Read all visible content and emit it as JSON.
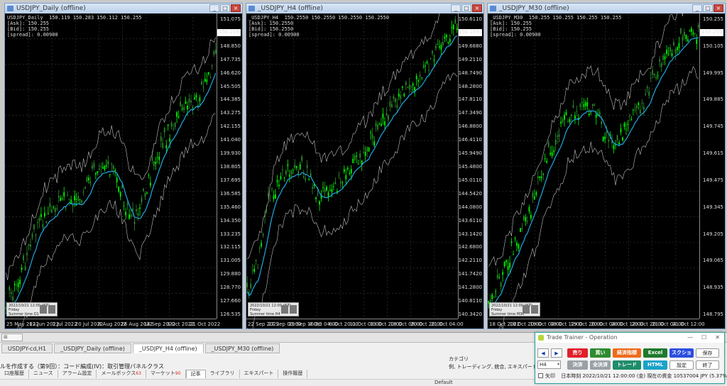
{
  "windows": [
    {
      "id": "daily",
      "title": "USDJPY_Daily (offline)",
      "info": [
        "USDJPY_Daily  150.119 150.283 150.112 150.255",
        "[Ask]: 150.255",
        "[Bid]: 150.255",
        "[spread]: 0.00900"
      ],
      "price_box": "150.255",
      "y_labels": [
        "151.075",
        "150.255",
        "148.850",
        "147.735",
        "146.620",
        "145.505",
        "144.385",
        "143.275",
        "142.155",
        "141.040",
        "139.930",
        "138.805",
        "137.695",
        "136.585",
        "135.460",
        "134.350",
        "133.235",
        "132.115",
        "131.005",
        "129.880",
        "128.770",
        "127.660",
        "126.535"
      ],
      "x_labels": [
        "25 May 2022",
        "13 Jun 2022",
        "1 Jul 2022",
        "20 Jul 2022",
        "8 Aug 2022",
        "26 Aug 2022",
        "14 Sep 2022",
        "3 Oct 2022",
        "21 Oct 2022"
      ],
      "mini": [
        "2022/10/21 12:00 (JST)",
        "Friday",
        "Summer time    D1"
      ]
    },
    {
      "id": "h4",
      "title": "_USDJPY_H4 (offline)",
      "info": [
        "_USDJPY_H4  150.2550 150.2550 150.2550 150.2550",
        "[Ask]: 150.2550",
        "[Bid]: 150.2550",
        "[spread]: 0.00900"
      ],
      "price_box": "150.2550",
      "y_labels": [
        "150.6110",
        "150.2550",
        "149.6880",
        "149.2110",
        "148.7490",
        "148.2800",
        "147.8110",
        "147.3490",
        "146.8800",
        "146.4110",
        "145.9490",
        "145.4800",
        "145.0110",
        "144.5420",
        "144.0800",
        "143.6110",
        "143.1420",
        "142.6800",
        "142.2110",
        "141.7420",
        "141.2800",
        "140.8110",
        "140.3420"
      ],
      "x_labels": [
        "22 Sep 2022",
        "27 Sep 00:00",
        "29 Sep 16:00",
        "4 Oct 04:00",
        "6 Oct 20:00",
        "11 Oct 08:00",
        "13 Oct 20:00",
        "18 Oct 08:00",
        "20 Oct 20:00",
        "21 Oct 04:00"
      ],
      "mini": [
        "2022/10/21 12:00 (JST)",
        "Friday",
        "Summer time    H4"
      ]
    },
    {
      "id": "m30",
      "title": "_USDJPY_M30 (offline)",
      "info": [
        "_USDJPY_M30  150.255 150.255 150.255 150.255",
        "[Ask]: 150.255",
        "[Bid]: 150.255",
        "[spread]: 0.00900"
      ],
      "price_box": "150.255",
      "y_labels": [
        "150.255",
        "150.105",
        "149.995",
        "149.885",
        "149.745",
        "149.615",
        "149.475",
        "149.345",
        "149.205",
        "149.065",
        "148.935",
        "148.795"
      ],
      "x_labels": [
        "18 Oct 2022",
        "18 Oct 20:00",
        "19 Oct 04:00",
        "19 Oct 12:00",
        "19 Oct 20:00",
        "20 Oct 04:00",
        "20 Oct 12:00",
        "20 Oct 20:00",
        "21 Oct 04:00",
        "21 Oct 12:00"
      ],
      "mini": [
        "2022/10/21 12:00 (JST)",
        "Friday",
        "Summer time    M30"
      ]
    }
  ],
  "terminal": {
    "window_tabs": [
      {
        "label": "USDJPY-cd,H1",
        "active": false
      },
      {
        "label": "_USDJPY_Daily (offline)",
        "active": false
      },
      {
        "label": "_USDJPY_H4 (offline)",
        "active": true
      },
      {
        "label": "_USDJPY_M30 (offline)",
        "active": false
      }
    ],
    "news_line": "ルを作成する（第9回）：コード編成(IV)：取引管理パネルクラス",
    "category_label": "カテゴリ",
    "category_value": "例, トレーディング, 統合, エキスパート",
    "bottom_tabs": [
      {
        "label": "口座履歴",
        "count": ""
      },
      {
        "label": "ニュース",
        "count": ""
      },
      {
        "label": "アラーム設定",
        "count": ""
      },
      {
        "label": "メールボックス",
        "count": "63"
      },
      {
        "label": "マーケット",
        "count": "90"
      },
      {
        "label": "記事",
        "count": "",
        "active": true
      },
      {
        "label": "ライブラリ",
        "count": ""
      },
      {
        "label": "エキスパート",
        "count": ""
      },
      {
        "label": "操作履歴",
        "count": ""
      }
    ],
    "status_default": "Default"
  },
  "trainer": {
    "title": "Trade Trainer - Operation",
    "ctrl_min": "—",
    "ctrl_max": "☐",
    "ctrl_close": "✕",
    "prev": "◀",
    "next": "▶",
    "buttons": [
      {
        "key": "sell",
        "label": "売り",
        "color": "#e0202a"
      },
      {
        "key": "buy",
        "label": "買い",
        "color": "#2e8b2e"
      },
      {
        "key": "econ",
        "label": "経済指標",
        "color": "#ef6a1b"
      },
      {
        "key": "excel",
        "label": "Excel",
        "color": "#1f7a2d"
      },
      {
        "key": "screenshot",
        "label": "スクショ",
        "color": "#2b4ee0"
      },
      {
        "key": "save",
        "label": "保存",
        "color": "#ffffff"
      },
      {
        "key": "settle",
        "label": "決済",
        "color": "#9aa0a6"
      },
      {
        "key": "settle-all",
        "label": "全決済",
        "color": "#9aa0a6"
      },
      {
        "key": "trade",
        "label": "トレード",
        "color": "#1f8c6a"
      },
      {
        "key": "html",
        "label": "HTML",
        "color": "#1aa2c9"
      },
      {
        "key": "settings",
        "label": "設定",
        "color": "#ffffff"
      },
      {
        "key": "exit",
        "label": "終了",
        "color": "#ffffff"
      }
    ],
    "timeframe": "H4",
    "arrow_label": "矢印",
    "status": "日本時刻 2022/10/21 12:00:00 (金)   現在の資金 10537004 JPY (5.37%)"
  },
  "colors": {
    "candle_up": "#00ff00",
    "candle_down": "#2e8b2e",
    "ma": "#1fa8e0",
    "band": "#c0c0c0",
    "grid": "#3a3a3a"
  }
}
